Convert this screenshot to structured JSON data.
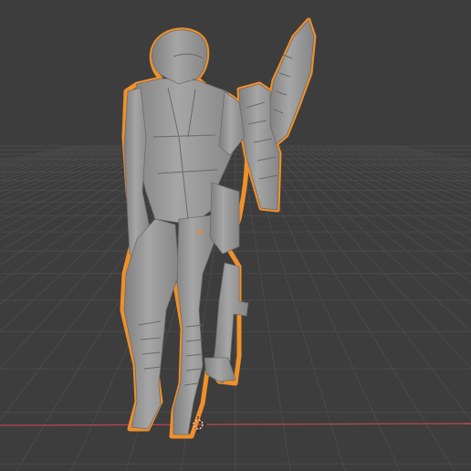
{
  "viewport": {
    "background": "#3d3d3d",
    "grid_color": "#4a4a4a",
    "x_axis_color": "#b8474f",
    "selection_outline": "#f0902a",
    "mesh_color": "#9a9a9a"
  },
  "object": {
    "icon": "figure-icon",
    "selected": true
  },
  "origin_marker": {
    "icon": "3d-cursor-icon"
  }
}
